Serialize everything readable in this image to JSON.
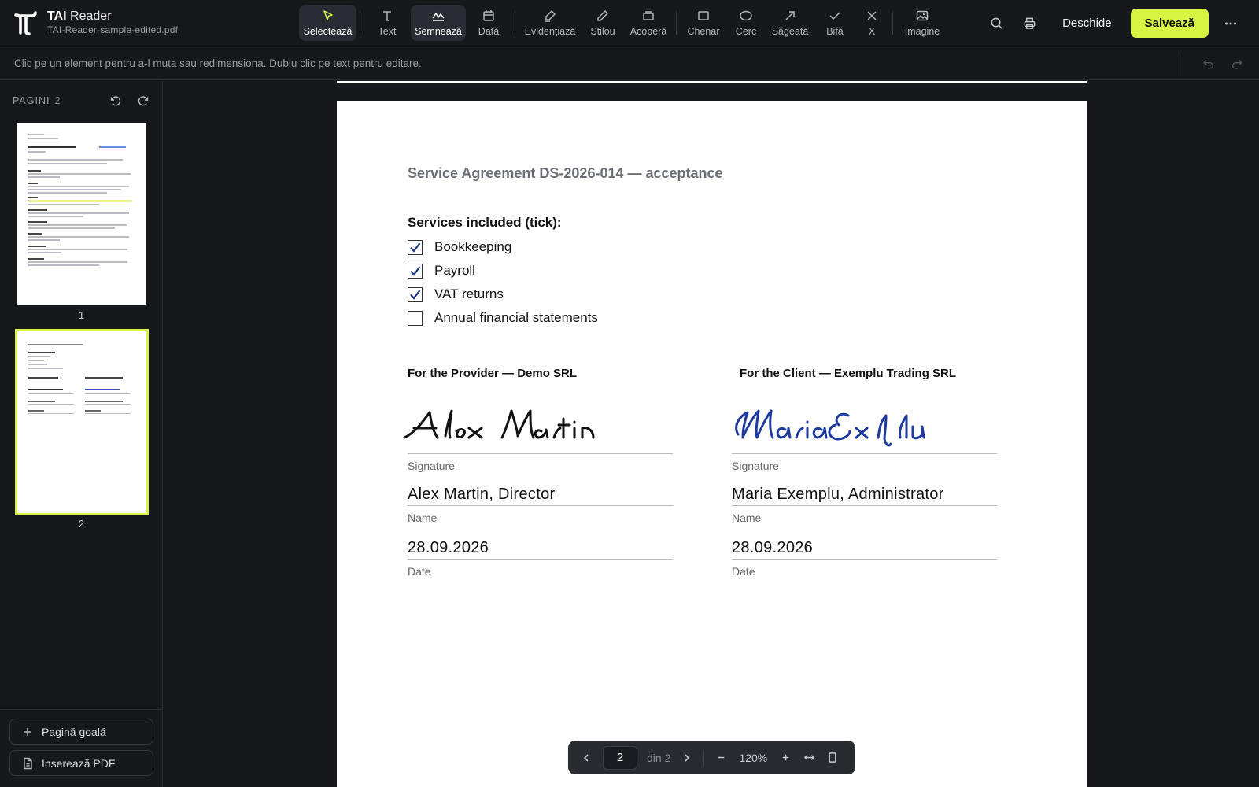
{
  "app": {
    "name_bold": "TAI",
    "name_light": "Reader",
    "filename": "TAI-Reader-sample-edited.pdf"
  },
  "toolbar": {
    "tools": [
      {
        "id": "select",
        "label": "Selectează",
        "icon": "cursor-icon"
      },
      {
        "id": "text",
        "label": "Text",
        "icon": "text-icon"
      },
      {
        "id": "sign",
        "label": "Semnează",
        "icon": "signature-icon"
      },
      {
        "id": "date",
        "label": "Dată",
        "icon": "calendar-icon"
      },
      {
        "id": "highlight",
        "label": "Evidențiază",
        "icon": "highlighter-icon"
      },
      {
        "id": "pen",
        "label": "Stilou",
        "icon": "pen-icon"
      },
      {
        "id": "cover",
        "label": "Acoperă",
        "icon": "cover-icon"
      },
      {
        "id": "rect",
        "label": "Chenar",
        "icon": "rectangle-icon"
      },
      {
        "id": "circle",
        "label": "Cerc",
        "icon": "circle-icon"
      },
      {
        "id": "arrow",
        "label": "Săgeată",
        "icon": "arrow-icon"
      },
      {
        "id": "check",
        "label": "Bifă",
        "icon": "check-icon"
      },
      {
        "id": "x",
        "label": "X",
        "icon": "x-icon"
      },
      {
        "id": "image",
        "label": "Imagine",
        "icon": "image-icon"
      }
    ],
    "open_label": "Deschide",
    "save_label": "Salvează",
    "accent": "#d7f442"
  },
  "hint": "Clic pe un element pentru a-l muta sau redimensiona. Dublu clic pe text pentru editare.",
  "sidebar": {
    "title": "PAGINI",
    "count": "2",
    "pages": [
      "1",
      "2"
    ],
    "selected_page": "2",
    "blank_page_label": "Pagină goală",
    "insert_pdf_label": "Inserează PDF"
  },
  "document": {
    "title": "Service Agreement DS-2026-014 — acceptance",
    "services_heading": "Services included (tick):",
    "services": [
      {
        "label": "Bookkeeping",
        "checked": true
      },
      {
        "label": "Payroll",
        "checked": true
      },
      {
        "label": "VAT returns",
        "checked": true
      },
      {
        "label": "Annual financial statements",
        "checked": false
      }
    ],
    "provider": {
      "heading": "For the Provider — Demo SRL",
      "signature_script": "Alex Martin",
      "signature_caption": "Signature",
      "name": "Alex Martin, Director",
      "name_caption": "Name",
      "date": "28.09.2026",
      "date_caption": "Date"
    },
    "client": {
      "heading": "For the Client — Exemplu Trading SRL",
      "signature_script": "Maria Exemplu",
      "signature_caption": "Signature",
      "name": "Maria Exemplu, Administrator",
      "name_caption": "Name",
      "date": "28.09.2026",
      "date_caption": "Date"
    }
  },
  "pager": {
    "current": "2",
    "of_label": "din 2",
    "zoom": "120%"
  }
}
